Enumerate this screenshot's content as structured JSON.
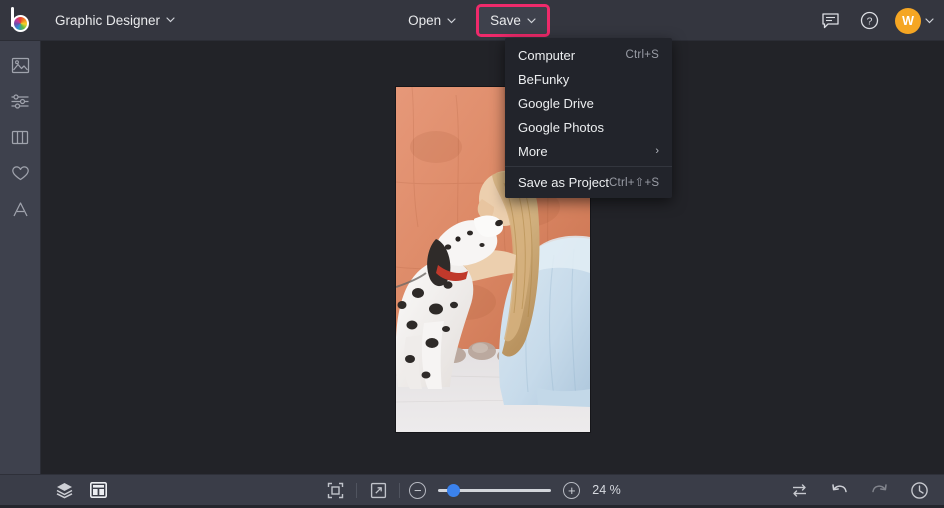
{
  "topbar": {
    "logo_name": "befunky-logo",
    "app_title": "Graphic Designer",
    "chevron": "⌄",
    "open_label": "Open",
    "save_label": "Save",
    "highlight_color": "#ef2a6b",
    "avatar_initial": "W",
    "avatar_color": "#f5a623",
    "icons": [
      "feedback-icon",
      "help-icon"
    ]
  },
  "sidebar": {
    "items": [
      {
        "name": "image-tool",
        "label": "Image"
      },
      {
        "name": "edit-tool",
        "label": "Edit"
      },
      {
        "name": "layouts-tool",
        "label": "Layouts"
      },
      {
        "name": "graphics-tool",
        "label": "Graphics"
      },
      {
        "name": "text-tool",
        "label": "Text"
      }
    ]
  },
  "save_menu": {
    "items": [
      {
        "label": "Computer",
        "shortcut": "Ctrl+S",
        "arrow": ""
      },
      {
        "label": "BeFunky",
        "shortcut": "",
        "arrow": ""
      },
      {
        "label": "Google Drive",
        "shortcut": "",
        "arrow": ""
      },
      {
        "label": "Google Photos",
        "shortcut": "",
        "arrow": ""
      },
      {
        "label": "More",
        "shortcut": "",
        "arrow": "›"
      }
    ],
    "footer": {
      "label": "Save as Project",
      "shortcut": "Ctrl+⇧+S"
    }
  },
  "canvas": {
    "image_alt": "dalmatian-dog-and-woman-by-terracotta-wall",
    "background": "#222328",
    "colors": {
      "wall": "#e0906f",
      "wall_shadow": "#c9714f",
      "pavement": "#e9e7e8",
      "dress": "#cfe0ec",
      "hair": "#d9b784",
      "dog_white": "#f4f2f1"
    }
  },
  "bottombar": {
    "layers_label": "Layers",
    "layout_label": "Layout",
    "fit_label": "Fit to screen",
    "expand_label": "Expand",
    "zoom_out": "−",
    "zoom_in": "+",
    "zoom_value": "24 %",
    "slider_percent": 8,
    "slider_color": "#3b82ed",
    "compare_label": "Compare",
    "undo_label": "Undo",
    "redo_label": "Redo",
    "history_label": "History"
  }
}
